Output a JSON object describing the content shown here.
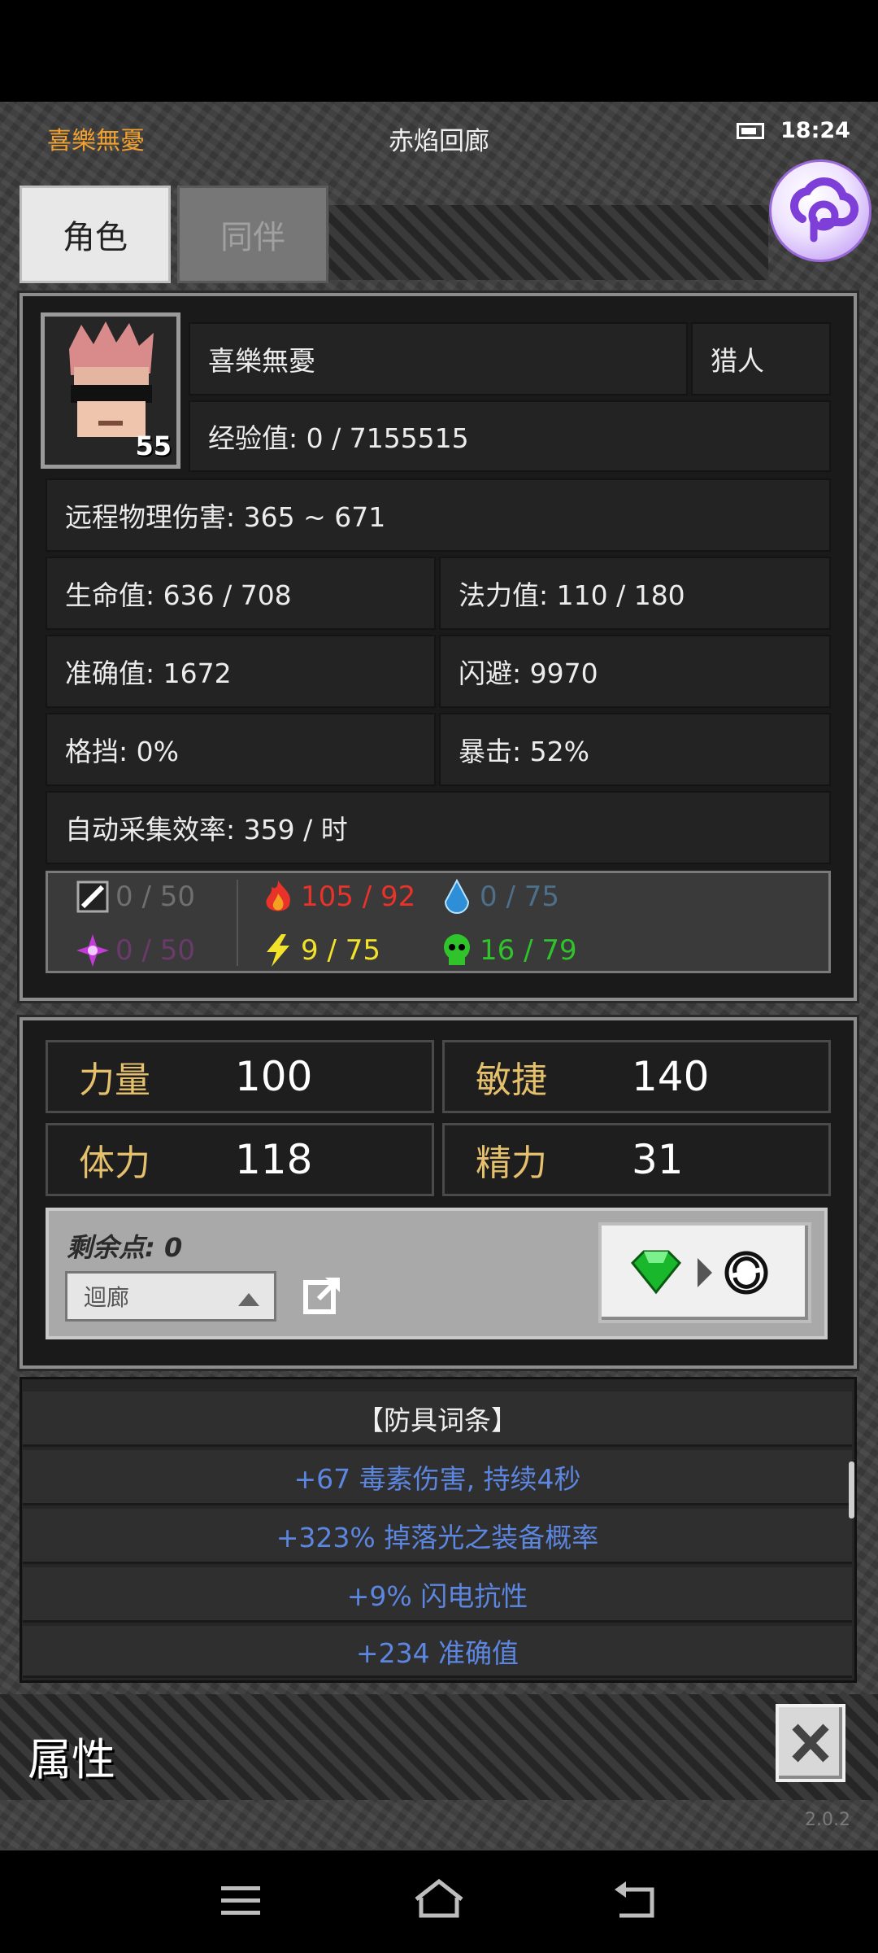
{
  "header": {
    "player_name": "喜樂無憂",
    "location": "赤焰回廊",
    "time": "18:24"
  },
  "tabs": [
    {
      "label": "角色",
      "active": true
    },
    {
      "label": "同伴",
      "active": false
    }
  ],
  "character": {
    "name": "喜樂無憂",
    "class": "猎人",
    "level": "55",
    "exp": "经验值: 0 / 7155515",
    "damage": "远程物理伤害: 365 ~ 671",
    "hp": "生命值: 636 / 708",
    "mp": "法力值: 110 / 180",
    "accuracy": "准确值: 1672",
    "dodge": "闪避: 9970",
    "block": "格挡: 0%",
    "crit": "暴击: 52%",
    "gather": "自动采集效率: 359 / 时"
  },
  "resistances": [
    {
      "name": "physical-icon",
      "value": "0 / 50",
      "color": "#6f6f6f"
    },
    {
      "name": "fire-icon",
      "value": "105 / 92",
      "color": "#e8322a"
    },
    {
      "name": "water-icon",
      "value": "0 / 75",
      "color": "#4d6f8a"
    },
    {
      "name": "arcane-icon",
      "value": "0 / 50",
      "color": "#6a3a6a"
    },
    {
      "name": "lightning-icon",
      "value": "9 / 75",
      "color": "#f2e22a"
    },
    {
      "name": "poison-icon",
      "value": "16 / 79",
      "color": "#30c32c"
    }
  ],
  "attributes": {
    "strength": {
      "label": "力量",
      "value": "100"
    },
    "agility": {
      "label": "敏捷",
      "value": "140"
    },
    "stamina": {
      "label": "体力",
      "value": "118"
    },
    "energy": {
      "label": "精力",
      "value": "31"
    }
  },
  "points": {
    "remaining": "剩余点: 0",
    "dropdown_value": "迴廊"
  },
  "affixes": {
    "header": "【防具词条】",
    "items": [
      "+67 毒素伤害, 持续4秒",
      "+323% 掉落光之装备概率",
      "+9% 闪电抗性",
      "+234 准确值"
    ]
  },
  "footer": {
    "title": "属性",
    "version": "2.0.2"
  },
  "colors": {
    "accent_name": "#f0a030",
    "attr_label": "#e4bf6c",
    "affix_blue": "#5c86e0"
  }
}
